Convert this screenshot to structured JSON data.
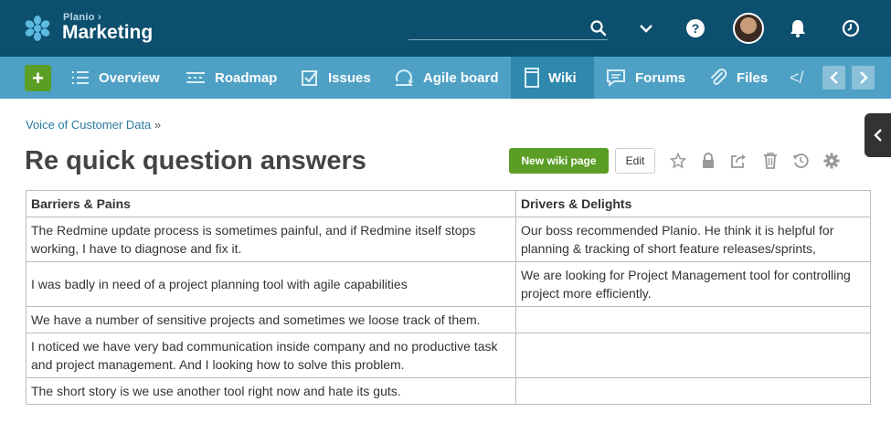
{
  "header": {
    "parent_project": "Planio ›",
    "project_name": "Marketing",
    "search_placeholder": ""
  },
  "nav": {
    "items": [
      {
        "label": "Overview",
        "icon": "list-icon"
      },
      {
        "label": "Roadmap",
        "icon": "roadmap-icon"
      },
      {
        "label": "Issues",
        "icon": "checkbox-icon"
      },
      {
        "label": "Agile board",
        "icon": "agile-icon"
      },
      {
        "label": "Wiki",
        "icon": "document-icon",
        "active": true
      },
      {
        "label": "Forums",
        "icon": "speech-bubble-icon"
      },
      {
        "label": "Files",
        "icon": "paperclip-icon"
      }
    ],
    "code_label": "</"
  },
  "breadcrumb": {
    "parent": "Voice of Customer Data",
    "separator": "»"
  },
  "page": {
    "title": "Re quick question answers",
    "new_wiki_button": "New wiki page",
    "edit_button": "Edit"
  },
  "table": {
    "headers": [
      "Barriers & Pains",
      "Drivers & Delights"
    ],
    "rows": [
      [
        "The Redmine update process is sometimes painful, and if Redmine itself stops working, I have to diagnose and fix it.",
        "Our boss recommended Planio. He think it is helpful for planning & tracking of short feature releases/sprints,"
      ],
      [
        "I was badly in need of a project planning tool with agile capabilities",
        "We are looking for Project Management tool for controlling project more efficiently."
      ],
      [
        "We have a number of sensitive projects and sometimes we loose track of them.",
        ""
      ],
      [
        "I noticed we have very bad communication inside company and no productive task and project management. And I looking how to solve this problem.",
        ""
      ],
      [
        "The short story is we use another tool right now and hate its guts.",
        ""
      ]
    ]
  },
  "colors": {
    "header_bg": "#0d4f6e",
    "nav_bg": "#4ea0c4",
    "nav_active_bg": "#2f88ad",
    "primary_green": "#5a9e26",
    "link": "#2a7aa0"
  }
}
